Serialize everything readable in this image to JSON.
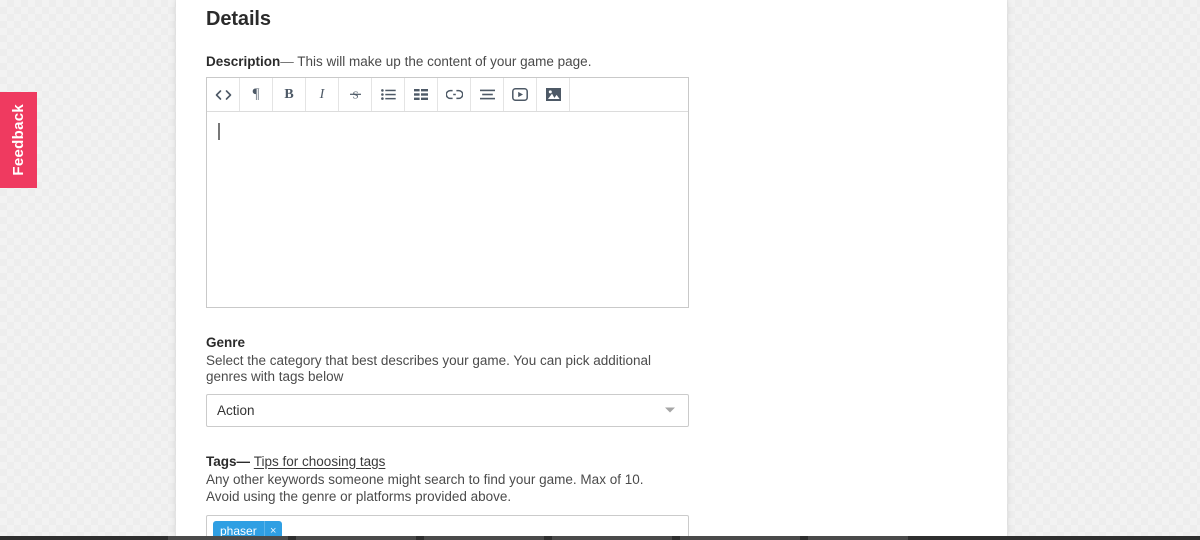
{
  "feedback": {
    "label": "Feedback",
    "color": "#ef3a60"
  },
  "section": {
    "title": "Details"
  },
  "description": {
    "label": "Description",
    "dash": "—",
    "helper": "This will make up the content of your game page.",
    "value": "",
    "toolbar": [
      {
        "name": "code-icon",
        "title": "Code"
      },
      {
        "name": "paragraph-icon",
        "title": "Paragraph"
      },
      {
        "name": "bold-icon",
        "title": "Bold"
      },
      {
        "name": "italic-icon",
        "title": "Italic"
      },
      {
        "name": "strikethrough-icon",
        "title": "Strikethrough"
      },
      {
        "name": "bullet-list-icon",
        "title": "Bullet list"
      },
      {
        "name": "table-icon",
        "title": "Table"
      },
      {
        "name": "link-icon",
        "title": "Link"
      },
      {
        "name": "align-icon",
        "title": "Align"
      },
      {
        "name": "video-icon",
        "title": "Video"
      },
      {
        "name": "image-icon",
        "title": "Image"
      }
    ]
  },
  "genre": {
    "label": "Genre",
    "helper": "Select the category that best describes your game. You can pick additional genres with tags below",
    "selected": "Action"
  },
  "tags": {
    "label": "Tags",
    "dash": "—",
    "link": "Tips for choosing tags",
    "helper_line_1": "Any other keywords someone might search to find your game. Max of 10.",
    "helper_line_2": "Avoid using the genre or platforms provided above.",
    "chips": [
      {
        "label": "phaser",
        "remove": "×",
        "color": "#2f9fe3"
      }
    ],
    "input_placeholder": ""
  }
}
